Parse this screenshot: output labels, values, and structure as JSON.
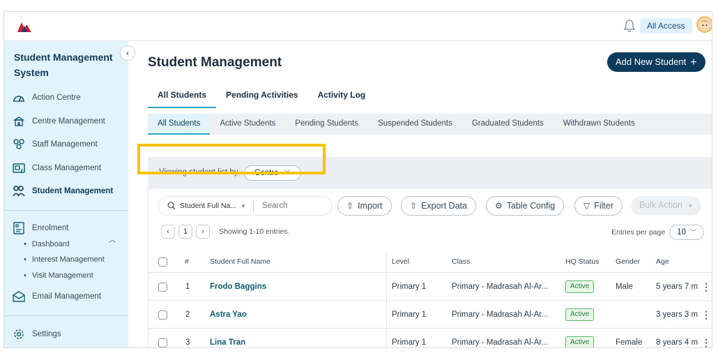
{
  "topbar": {
    "access_label": "All Access"
  },
  "sidebar": {
    "title": "Student Management System",
    "items": [
      {
        "label": "Action Centre",
        "icon": "gauge-icon"
      },
      {
        "label": "Centre Management",
        "icon": "building-icon"
      },
      {
        "label": "Staff Management",
        "icon": "people-icon"
      },
      {
        "label": "Class Management",
        "icon": "classroom-icon"
      },
      {
        "label": "Student Management",
        "icon": "students-icon",
        "active": true
      }
    ],
    "enrolment": {
      "label": "Enrolment",
      "subitems": [
        "Dashboard",
        "Interest Management",
        "Visit Management"
      ]
    },
    "email": {
      "label": "Email Management"
    },
    "settings": {
      "label": "Settings"
    }
  },
  "main": {
    "page_title": "Student Management",
    "add_button": "Add New Student",
    "tabs": [
      "All Students",
      "Pending Activities",
      "Activity Log"
    ],
    "subtabs": [
      "All Students",
      "Active Students",
      "Pending Students",
      "Suspended Students",
      "Graduated Students",
      "Withdrawn Students"
    ],
    "viewing_label": "Viewing student list by",
    "viewing_value": "Centre",
    "toolbar": {
      "search_category": "Student Full Na...",
      "search_placeholder": "Search",
      "import": "Import",
      "export": "Export Data",
      "table_config": "Table Config",
      "filter": "Filter",
      "bulk_action": "Bulk Action"
    },
    "pagination": {
      "current_page": "1",
      "showing": "Showing 1-10 entries.",
      "entries_label": "Entries per page",
      "entries_value": "10"
    },
    "table": {
      "columns": [
        "#",
        "Student Full Name",
        "Level",
        "Class",
        "HQ Status",
        "Gender",
        "Age"
      ],
      "rows": [
        {
          "num": "1",
          "name": "Frodo Baggins",
          "level": "Primary 1",
          "class": "Primary - Madrasah Al-Ar...",
          "status": "Active",
          "gender": "Male",
          "age": "5 years 7 m"
        },
        {
          "num": "2",
          "name": "Astra Yao",
          "level": "Primary 1",
          "class": "Primary - Madrasah Al-Ar...",
          "status": "Active",
          "gender": "",
          "age": "3 years 3 m"
        },
        {
          "num": "3",
          "name": "Lina Tran",
          "level": "Primary 1",
          "class": "Primary - Madrasah Al-Ar...",
          "status": "Active",
          "gender": "Female",
          "age": "8 years 4 m"
        }
      ]
    }
  },
  "colors": {
    "primary": "#0d3b5b",
    "accent": "#2aa6c8",
    "sidebar_bg": "#e3f3fb",
    "highlight": "#f5c400",
    "active_badge": "#58b86a"
  }
}
